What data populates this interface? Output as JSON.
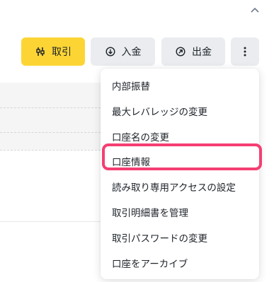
{
  "toolbar": {
    "trade_label": "取引",
    "deposit_label": "入金",
    "withdraw_label": "出金",
    "more_icon": "more-vertical-icon"
  },
  "header": {
    "collapse_icon": "chevron-up-icon"
  },
  "menu": {
    "items": [
      {
        "label": "内部振替"
      },
      {
        "label": "最大レバレッジの変更"
      },
      {
        "label": "口座名の変更"
      },
      {
        "label": "口座情報",
        "highlighted": true
      },
      {
        "label": "読み取り専用アクセスの設定"
      },
      {
        "label": "取引明細書を管理"
      },
      {
        "label": "取引パスワードの変更"
      },
      {
        "label": "口座をアーカイブ"
      }
    ]
  },
  "colors": {
    "accent_yellow": "#fcd535",
    "button_gray": "#eaecef",
    "highlight_pink": "#f43f73",
    "text": "#1e2329"
  }
}
